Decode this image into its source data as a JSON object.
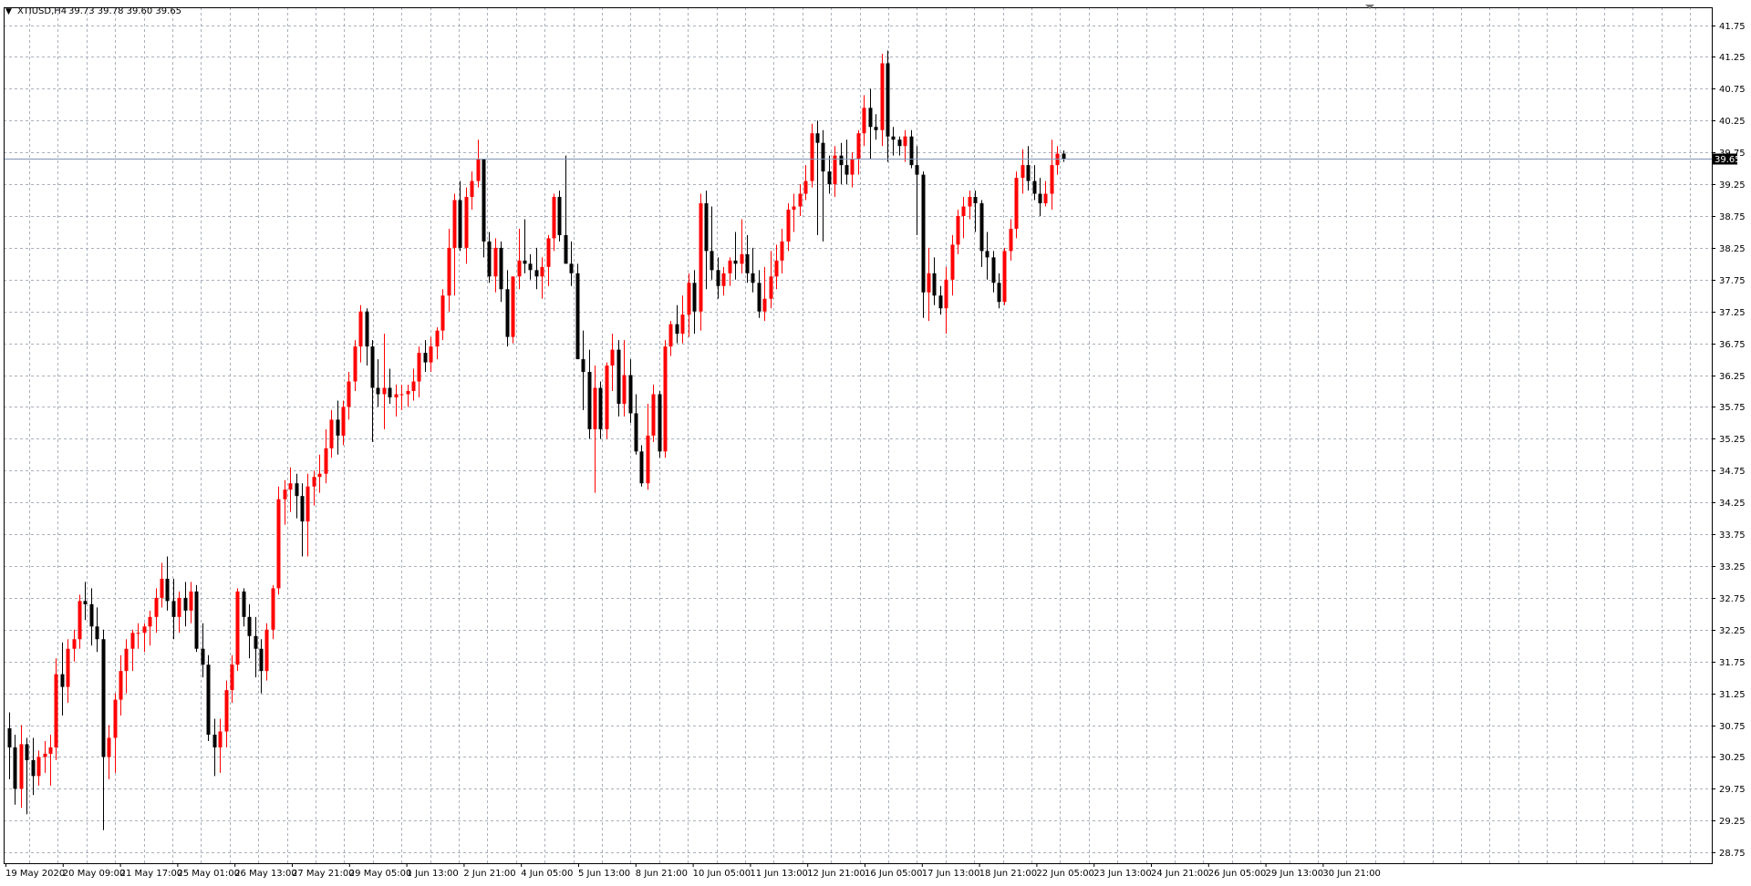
{
  "header": {
    "arrow": "▼",
    "symbol": "XTIUSD,H4",
    "ohlc": "39.73 39.78 39.60 39.65"
  },
  "current_price_label": "39.65",
  "colors": {
    "bull": "#ff0000",
    "bear": "#000000",
    "grid": "#aab0bb",
    "price_line": "#7f93b3",
    "price_tag_bg": "#000000",
    "price_tag_fg": "#ffffff"
  },
  "chart_data": {
    "type": "candlestick",
    "y_ticks": [
      "28.75",
      "29.25",
      "29.75",
      "30.25",
      "30.75",
      "31.25",
      "31.75",
      "32.25",
      "32.75",
      "33.25",
      "33.75",
      "34.25",
      "34.75",
      "35.25",
      "35.75",
      "36.25",
      "36.75",
      "37.25",
      "37.75",
      "38.25",
      "38.75",
      "39.25",
      "39.75",
      "40.25",
      "40.75",
      "41.25",
      "41.75"
    ],
    "x_ticks": [
      "19 May 2020",
      "20 May 09:00",
      "21 May 17:00",
      "25 May 01:00",
      "26 May 13:00",
      "27 May 21:00",
      "29 May 05:00",
      "1 Jun 13:00",
      "2 Jun 21:00",
      "4 Jun 05:00",
      "5 Jun 13:00",
      "8 Jun 21:00",
      "10 Jun 05:00",
      "11 Jun 13:00",
      "12 Jun 21:00",
      "16 Jun 05:00",
      "17 Jun 13:00",
      "18 Jun 21:00",
      "22 Jun 05:00",
      "23 Jun 13:00",
      "24 Jun 21:00",
      "26 Jun 05:00",
      "29 Jun 13:00",
      "30 Jun 21:00"
    ],
    "ylim": [
      28.58,
      42.03
    ],
    "current_price": 39.65,
    "ohlc": [
      [
        30.7,
        30.95,
        29.9,
        30.4
      ],
      [
        30.4,
        30.6,
        29.5,
        29.75
      ],
      [
        29.75,
        30.75,
        29.45,
        30.45
      ],
      [
        30.45,
        30.55,
        29.35,
        30.2
      ],
      [
        30.2,
        30.55,
        29.65,
        29.95
      ],
      [
        29.95,
        30.35,
        29.8,
        30.25
      ],
      [
        30.25,
        30.5,
        30.0,
        30.3
      ],
      [
        30.3,
        30.6,
        29.8,
        30.4
      ],
      [
        30.4,
        31.8,
        30.2,
        31.55
      ],
      [
        31.55,
        32.05,
        30.9,
        31.35
      ],
      [
        31.35,
        32.1,
        31.1,
        31.95
      ],
      [
        31.95,
        32.25,
        31.75,
        32.1
      ],
      [
        32.1,
        32.8,
        31.95,
        32.7
      ],
      [
        32.7,
        33.0,
        32.4,
        32.65
      ],
      [
        32.65,
        32.9,
        32.0,
        32.3
      ],
      [
        32.3,
        32.6,
        31.9,
        32.1
      ],
      [
        32.1,
        32.25,
        29.1,
        30.25
      ],
      [
        30.25,
        30.75,
        29.9,
        30.55
      ],
      [
        30.55,
        31.25,
        30.0,
        31.15
      ],
      [
        31.15,
        31.85,
        30.9,
        31.6
      ],
      [
        31.6,
        32.1,
        31.25,
        31.95
      ],
      [
        31.95,
        32.25,
        31.6,
        32.2
      ],
      [
        32.2,
        32.35,
        31.95,
        32.2
      ],
      [
        32.2,
        32.35,
        31.9,
        32.3
      ],
      [
        32.3,
        32.55,
        32.0,
        32.45
      ],
      [
        32.45,
        32.9,
        32.2,
        32.75
      ],
      [
        32.75,
        33.3,
        32.6,
        33.05
      ],
      [
        33.05,
        33.4,
        32.55,
        32.7
      ],
      [
        32.7,
        33.05,
        32.1,
        32.45
      ],
      [
        32.45,
        32.85,
        32.2,
        32.75
      ],
      [
        32.75,
        33.0,
        32.3,
        32.55
      ],
      [
        32.55,
        33.0,
        32.35,
        32.85
      ],
      [
        32.85,
        32.95,
        31.9,
        31.95
      ],
      [
        31.95,
        32.35,
        31.5,
        31.7
      ],
      [
        31.7,
        31.85,
        30.5,
        30.6
      ],
      [
        30.6,
        30.85,
        29.95,
        30.4
      ],
      [
        30.4,
        30.85,
        30.0,
        30.65
      ],
      [
        30.65,
        31.45,
        30.4,
        31.3
      ],
      [
        31.3,
        31.85,
        31.1,
        31.7
      ],
      [
        31.7,
        32.9,
        31.6,
        32.85
      ],
      [
        32.85,
        32.9,
        32.3,
        32.45
      ],
      [
        32.45,
        32.65,
        31.8,
        32.15
      ],
      [
        32.15,
        32.45,
        31.5,
        31.95
      ],
      [
        31.95,
        32.1,
        31.25,
        31.6
      ],
      [
        31.6,
        32.35,
        31.45,
        32.25
      ],
      [
        32.25,
        32.95,
        32.1,
        32.9
      ],
      [
        32.9,
        34.5,
        32.8,
        34.3
      ],
      [
        34.3,
        34.6,
        33.9,
        34.45
      ],
      [
        34.45,
        34.8,
        34.1,
        34.55
      ],
      [
        34.55,
        34.7,
        34.0,
        34.35
      ],
      [
        34.35,
        34.55,
        33.4,
        33.95
      ],
      [
        33.95,
        34.7,
        33.4,
        34.5
      ],
      [
        34.5,
        34.75,
        34.2,
        34.65
      ],
      [
        34.65,
        35.0,
        34.4,
        34.7
      ],
      [
        34.7,
        35.4,
        34.55,
        35.1
      ],
      [
        35.1,
        35.7,
        34.95,
        35.55
      ],
      [
        35.55,
        35.85,
        35.0,
        35.3
      ],
      [
        35.3,
        35.85,
        35.15,
        35.75
      ],
      [
        35.75,
        36.3,
        35.55,
        36.15
      ],
      [
        36.15,
        36.8,
        36.0,
        36.7
      ],
      [
        36.7,
        37.35,
        36.45,
        37.25
      ],
      [
        37.25,
        37.3,
        36.4,
        36.7
      ],
      [
        36.7,
        36.8,
        35.2,
        36.05
      ],
      [
        36.05,
        36.5,
        35.75,
        35.95
      ],
      [
        35.95,
        36.9,
        35.4,
        36.05
      ],
      [
        36.05,
        36.35,
        35.8,
        35.9
      ],
      [
        35.9,
        36.1,
        35.6,
        35.95
      ],
      [
        35.95,
        36.1,
        35.7,
        35.95
      ],
      [
        35.95,
        36.1,
        35.75,
        36.0
      ],
      [
        36.0,
        36.35,
        35.85,
        36.15
      ],
      [
        36.15,
        36.7,
        35.9,
        36.6
      ],
      [
        36.6,
        36.8,
        36.3,
        36.45
      ],
      [
        36.45,
        36.85,
        36.3,
        36.7
      ],
      [
        36.7,
        37.0,
        36.5,
        36.95
      ],
      [
        36.95,
        37.6,
        36.8,
        37.5
      ],
      [
        37.5,
        38.55,
        37.25,
        38.25
      ],
      [
        38.25,
        39.1,
        37.5,
        39.0
      ],
      [
        39.0,
        39.3,
        38.2,
        38.25
      ],
      [
        38.25,
        39.2,
        38.0,
        39.05
      ],
      [
        39.05,
        39.45,
        38.85,
        39.3
      ],
      [
        39.3,
        39.95,
        39.2,
        39.65
      ],
      [
        39.65,
        39.65,
        38.1,
        38.35
      ],
      [
        38.35,
        38.5,
        37.7,
        37.8
      ],
      [
        37.8,
        38.4,
        37.55,
        38.25
      ],
      [
        38.25,
        38.35,
        37.4,
        37.6
      ],
      [
        37.6,
        37.9,
        36.7,
        36.85
      ],
      [
        36.85,
        37.8,
        36.75,
        37.8
      ],
      [
        37.8,
        38.55,
        37.6,
        38.05
      ],
      [
        38.05,
        38.7,
        37.85,
        38.0
      ],
      [
        38.0,
        38.15,
        37.75,
        37.9
      ],
      [
        37.9,
        38.25,
        37.6,
        37.8
      ],
      [
        37.8,
        38.1,
        37.45,
        37.95
      ],
      [
        37.95,
        38.45,
        37.65,
        38.4
      ],
      [
        38.4,
        39.1,
        38.2,
        39.05
      ],
      [
        39.05,
        39.15,
        38.35,
        38.45
      ],
      [
        38.45,
        39.7,
        38.05,
        38.0
      ],
      [
        38.0,
        38.35,
        37.65,
        37.85
      ],
      [
        37.85,
        38.0,
        36.6,
        36.5
      ],
      [
        36.5,
        36.95,
        35.7,
        36.3
      ],
      [
        36.3,
        36.65,
        35.25,
        35.4
      ],
      [
        35.4,
        36.4,
        34.4,
        36.05
      ],
      [
        36.05,
        36.15,
        35.25,
        35.4
      ],
      [
        35.4,
        36.45,
        35.25,
        36.4
      ],
      [
        36.4,
        36.9,
        36.0,
        36.65
      ],
      [
        36.65,
        36.8,
        35.6,
        35.8
      ],
      [
        35.8,
        36.8,
        35.6,
        36.25
      ],
      [
        36.25,
        36.5,
        35.5,
        35.65
      ],
      [
        35.65,
        35.95,
        35.0,
        35.05
      ],
      [
        35.05,
        35.15,
        34.5,
        34.55
      ],
      [
        34.55,
        35.8,
        34.45,
        35.3
      ],
      [
        35.3,
        36.1,
        35.2,
        35.95
      ],
      [
        35.95,
        36.0,
        34.95,
        35.05
      ],
      [
        35.05,
        36.8,
        34.95,
        36.7
      ],
      [
        36.7,
        37.1,
        36.55,
        37.05
      ],
      [
        37.05,
        37.35,
        36.75,
        36.9
      ],
      [
        36.9,
        37.5,
        36.75,
        37.2
      ],
      [
        37.2,
        37.85,
        36.85,
        37.7
      ],
      [
        37.7,
        37.9,
        36.9,
        37.25
      ],
      [
        37.25,
        39.1,
        36.95,
        38.95
      ],
      [
        38.95,
        39.15,
        37.6,
        38.2
      ],
      [
        38.2,
        38.9,
        37.75,
        37.9
      ],
      [
        37.9,
        38.1,
        37.45,
        37.65
      ],
      [
        37.65,
        37.95,
        37.5,
        37.85
      ],
      [
        37.85,
        38.1,
        37.65,
        38.05
      ],
      [
        38.05,
        38.5,
        37.75,
        38.0
      ],
      [
        38.0,
        38.7,
        37.85,
        38.15
      ],
      [
        38.15,
        38.45,
        37.7,
        37.85
      ],
      [
        37.85,
        38.25,
        37.55,
        37.7
      ],
      [
        37.7,
        37.9,
        37.15,
        37.25
      ],
      [
        37.25,
        37.95,
        37.1,
        37.45
      ],
      [
        37.45,
        38.2,
        37.3,
        37.8
      ],
      [
        37.8,
        38.3,
        37.6,
        38.05
      ],
      [
        38.05,
        38.55,
        37.85,
        38.35
      ],
      [
        38.35,
        38.95,
        38.2,
        38.85
      ],
      [
        38.85,
        39.1,
        38.5,
        38.9
      ],
      [
        38.9,
        39.25,
        38.75,
        39.1
      ],
      [
        39.1,
        39.55,
        39.0,
        39.3
      ],
      [
        39.3,
        40.2,
        39.2,
        40.05
      ],
      [
        40.05,
        40.25,
        38.45,
        39.9
      ],
      [
        39.9,
        40.1,
        38.35,
        39.45
      ],
      [
        39.45,
        39.7,
        39.1,
        39.25
      ],
      [
        39.25,
        39.85,
        39.05,
        39.7
      ],
      [
        39.7,
        39.9,
        39.25,
        39.55
      ],
      [
        39.55,
        39.95,
        39.25,
        39.4
      ],
      [
        39.4,
        39.75,
        39.2,
        39.65
      ],
      [
        39.65,
        40.1,
        39.4,
        40.05
      ],
      [
        40.05,
        40.65,
        39.85,
        40.45
      ],
      [
        40.45,
        40.75,
        39.65,
        40.15
      ],
      [
        40.15,
        40.35,
        39.95,
        40.1
      ],
      [
        40.1,
        41.3,
        39.85,
        41.15
      ],
      [
        41.15,
        41.35,
        39.6,
        40.0
      ],
      [
        40.0,
        40.15,
        39.7,
        39.95
      ],
      [
        39.95,
        40.0,
        39.7,
        39.85
      ],
      [
        39.85,
        40.1,
        39.6,
        40.0
      ],
      [
        40.0,
        40.1,
        39.5,
        39.55
      ],
      [
        39.55,
        39.85,
        38.45,
        39.4
      ],
      [
        39.4,
        39.45,
        37.15,
        37.55
      ],
      [
        37.55,
        38.25,
        37.1,
        37.85
      ],
      [
        37.85,
        38.1,
        37.35,
        37.5
      ],
      [
        37.5,
        37.65,
        37.2,
        37.3
      ],
      [
        37.3,
        37.95,
        36.9,
        37.75
      ],
      [
        37.75,
        38.45,
        37.5,
        38.3
      ],
      [
        38.3,
        38.85,
        38.15,
        38.75
      ],
      [
        38.75,
        39.05,
        38.4,
        38.9
      ],
      [
        38.9,
        39.15,
        38.7,
        39.05
      ],
      [
        39.05,
        39.15,
        38.5,
        38.95
      ],
      [
        38.95,
        39.0,
        37.95,
        38.2
      ],
      [
        38.2,
        38.5,
        37.75,
        38.1
      ],
      [
        38.1,
        38.2,
        37.55,
        37.7
      ],
      [
        37.7,
        37.85,
        37.3,
        37.4
      ],
      [
        37.4,
        38.25,
        37.35,
        38.2
      ],
      [
        38.2,
        38.7,
        38.05,
        38.55
      ],
      [
        38.55,
        39.45,
        38.4,
        39.35
      ],
      [
        39.35,
        39.8,
        39.1,
        39.55
      ],
      [
        39.55,
        39.85,
        39.15,
        39.3
      ],
      [
        39.3,
        39.55,
        39.0,
        39.1
      ],
      [
        39.1,
        39.35,
        38.75,
        38.95
      ],
      [
        38.95,
        39.3,
        38.9,
        39.1
      ],
      [
        39.1,
        39.95,
        38.85,
        39.55
      ],
      [
        39.55,
        39.85,
        39.4,
        39.73
      ],
      [
        39.73,
        39.78,
        39.6,
        39.65
      ]
    ]
  }
}
